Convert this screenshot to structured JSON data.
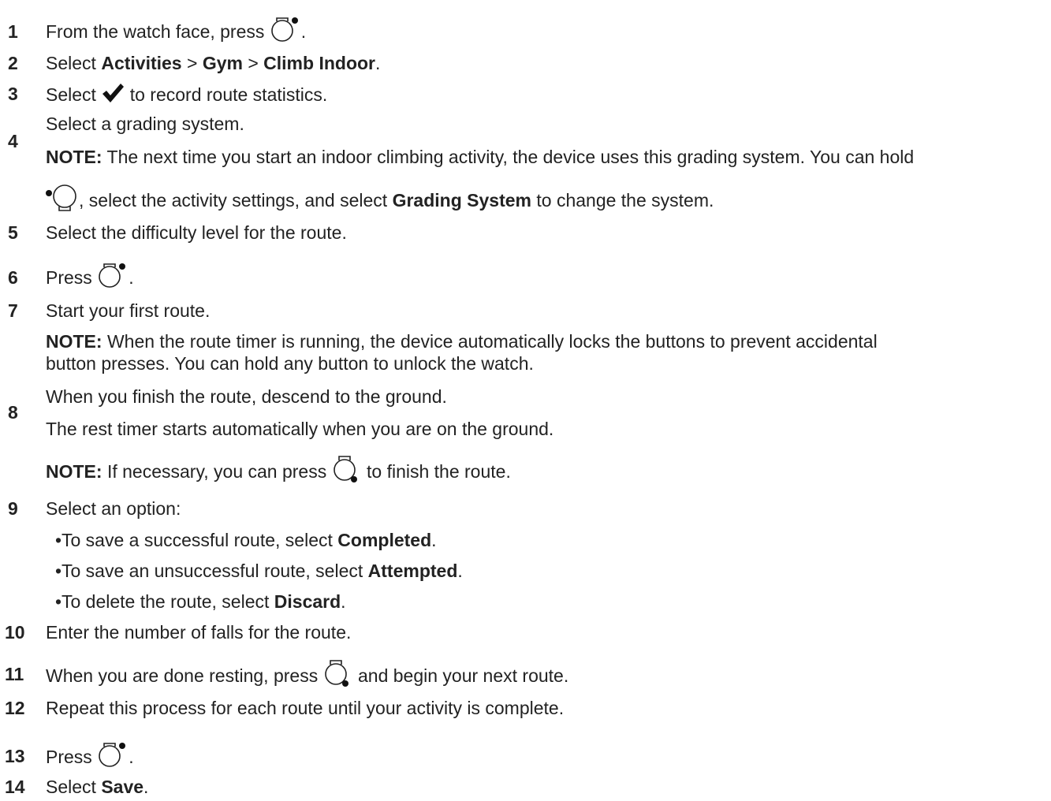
{
  "steps": {
    "s1": {
      "num": "1",
      "text_before": "From the watch face, press ",
      "text_after": "."
    },
    "s2": {
      "num": "2",
      "a": "Select ",
      "b": "Activities",
      "c": " > ",
      "d": "Gym",
      "e": " > ",
      "f": "Climb Indoor",
      "g": "."
    },
    "s3": {
      "num": "3",
      "a": "Select ",
      "b": " to record route statistics."
    },
    "s4": {
      "num": "4",
      "text": "Select a grading system.",
      "note_label": "NOTE:",
      "note_text": " The next time you start an indoor climbing activity, the device uses this grading system. You can hold",
      "note2_a": ", select the activity settings, and select ",
      "note2_b": "Grading System",
      "note2_c": " to change the system."
    },
    "s5": {
      "num": "5",
      "text": "Select the difficulty level for the route."
    },
    "s6": {
      "num": "6",
      "a": "Press ",
      "b": "."
    },
    "s7": {
      "num": "7",
      "text": "Start your first route.",
      "note_label": "NOTE:",
      "note_text": " When the route timer is running, the device automatically locks the buttons to prevent accidental",
      "note_line2": "button presses. You can hold any button to unlock the watch."
    },
    "s8": {
      "num": "8",
      "text": "When you finish the route, descend to the ground.",
      "text2": "The rest timer starts automatically when you are on the ground.",
      "note_label": "NOTE:",
      "note_a": " If necessary, you can press ",
      "note_b": " to finish the route."
    },
    "s9": {
      "num": "9",
      "text": "Select an option:",
      "bullet": "•",
      "options": [
        {
          "a": "To save a successful route, select ",
          "b": "Completed",
          "c": "."
        },
        {
          "a": "To save an unsuccessful route, select ",
          "b": "Attempted",
          "c": "."
        },
        {
          "a": "To delete the route, select ",
          "b": "Discard",
          "c": "."
        }
      ]
    },
    "s10": {
      "num": "10",
      "text": "Enter the number of falls for the route."
    },
    "s11": {
      "num": "11",
      "a": "When you are done resting, press ",
      "b": " and begin your next route."
    },
    "s12": {
      "num": "12",
      "text": "Repeat this process for each route until your activity is complete."
    },
    "s13": {
      "num": "13",
      "a": "Press ",
      "b": "."
    },
    "s14": {
      "num": "14",
      "a": "Select ",
      "b": "Save",
      "c": "."
    }
  },
  "icons": {
    "start_stop": "watch-button-top-right-icon",
    "light": "watch-button-left-icon",
    "back_lap": "watch-button-bottom-right-icon",
    "check": "checkmark-icon"
  }
}
